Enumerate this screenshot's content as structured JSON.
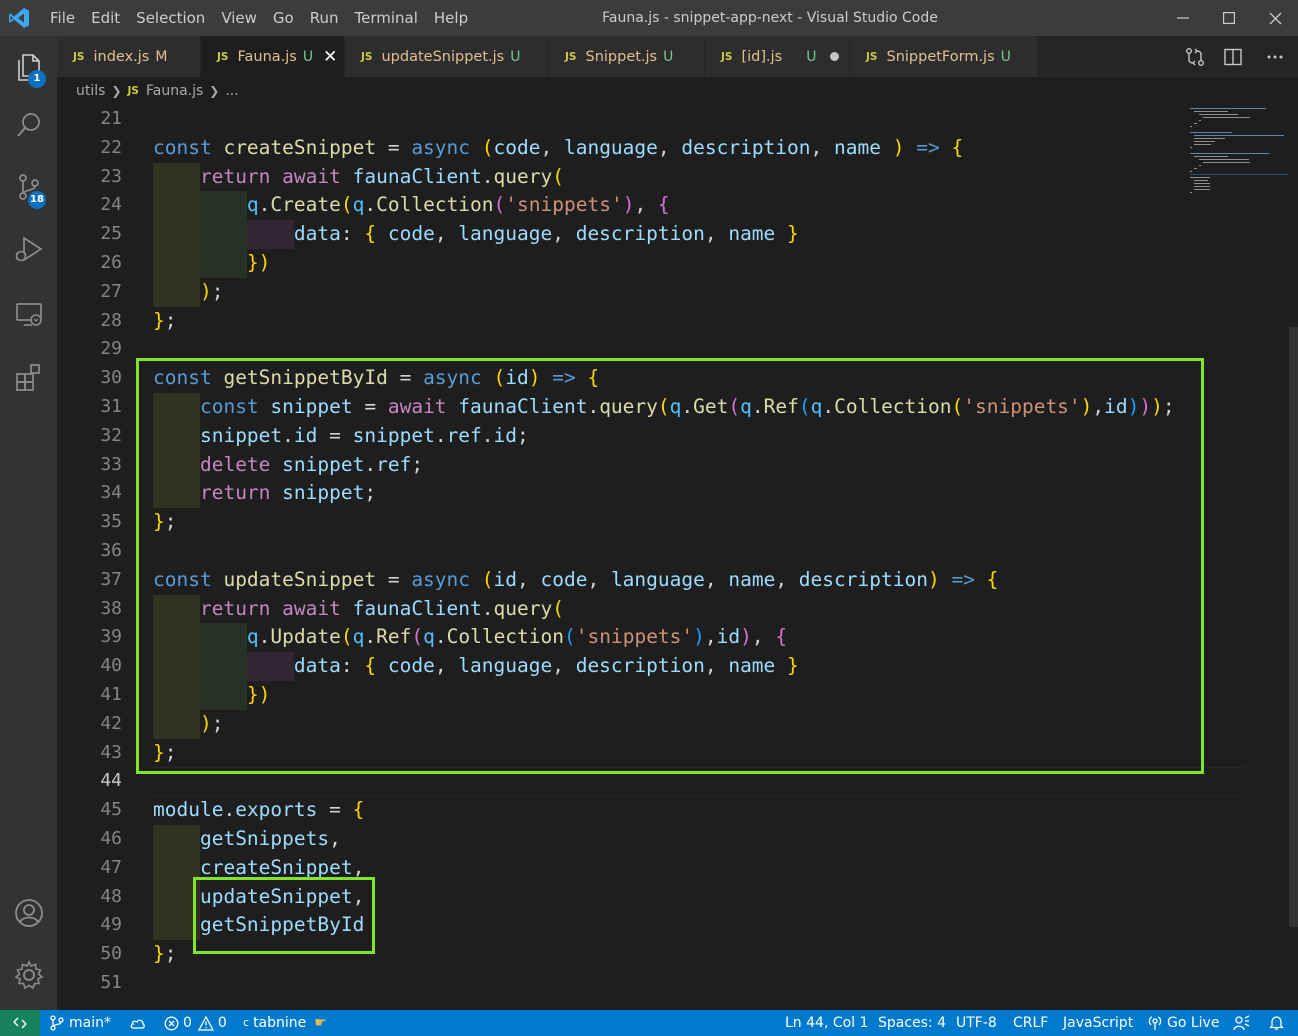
{
  "window": {
    "title": "Fauna.js - snippet-app-next - Visual Studio Code",
    "menu": [
      "File",
      "Edit",
      "Selection",
      "View",
      "Go",
      "Run",
      "Terminal",
      "Help"
    ]
  },
  "activity_bar": {
    "explorer_badge": "1",
    "scm_badge": "18",
    "icons": [
      "files-icon",
      "search-icon",
      "source-control-icon",
      "run-debug-icon",
      "remote-explorer-icon",
      "extensions-icon",
      "account-icon",
      "gear-icon"
    ]
  },
  "tabs": [
    {
      "name": "index.js",
      "status": "M",
      "active": false
    },
    {
      "name": "Fauna.js",
      "status": "U",
      "active": true
    },
    {
      "name": "updateSnippet.js",
      "status": "U",
      "active": false
    },
    {
      "name": "Snippet.js",
      "status": "U",
      "active": false
    },
    {
      "name": "[id].js",
      "status": "U",
      "active": false,
      "dirty": true
    },
    {
      "name": "SnippetForm.js",
      "status": "U",
      "active": false
    }
  ],
  "tab_icon_text": "JS",
  "breadcrumb": {
    "folder": "utils",
    "file": "Fauna.js",
    "more": "..."
  },
  "editor": {
    "current_line": 44,
    "line_numbers": [
      "21",
      "22",
      "23",
      "24",
      "25",
      "26",
      "27",
      "28",
      "29",
      "30",
      "31",
      "32",
      "33",
      "34",
      "35",
      "36",
      "37",
      "38",
      "39",
      "40",
      "41",
      "42",
      "43",
      "44",
      "45",
      "46",
      "47",
      "48",
      "49",
      "50",
      "51"
    ],
    "lines": [
      "",
      "const createSnippet = async (code, language, description, name ) => {",
      "    return await faunaClient.query(",
      "        q.Create(q.Collection('snippets'), {",
      "            data: { code, language, description, name }",
      "        })",
      "    );",
      "};",
      "",
      "const getSnippetById = async (id) => {",
      "    const snippet = await faunaClient.query(q.Get(q.Ref(q.Collection('snippets'),id)));",
      "    snippet.id = snippet.ref.id;",
      "    delete snippet.ref;",
      "    return snippet;",
      "};",
      "",
      "const updateSnippet = async (id, code, language, name, description) => {",
      "    return await faunaClient.query(",
      "        q.Update(q.Ref(q.Collection('snippets'),id), {",
      "            data: { code, language, description, name }",
      "        })",
      "    );",
      "};",
      "",
      "module.exports = {",
      "    getSnippets,",
      "    createSnippet,",
      "    updateSnippet,",
      "    getSnippetById",
      "};",
      ""
    ]
  },
  "status_bar": {
    "branch": "main*",
    "errors": "0",
    "warnings": "0",
    "tabnine": "tabnine",
    "position": "Ln 44, Col 1",
    "spaces": "Spaces: 4",
    "encoding": "UTF-8",
    "eol": "CRLF",
    "language": "JavaScript",
    "golive": "Go Live"
  },
  "colors": {
    "accent": "#007acc",
    "highlight_box": "#7fe52a",
    "remote_button": "#16825d",
    "badge": "#0e70c0"
  }
}
